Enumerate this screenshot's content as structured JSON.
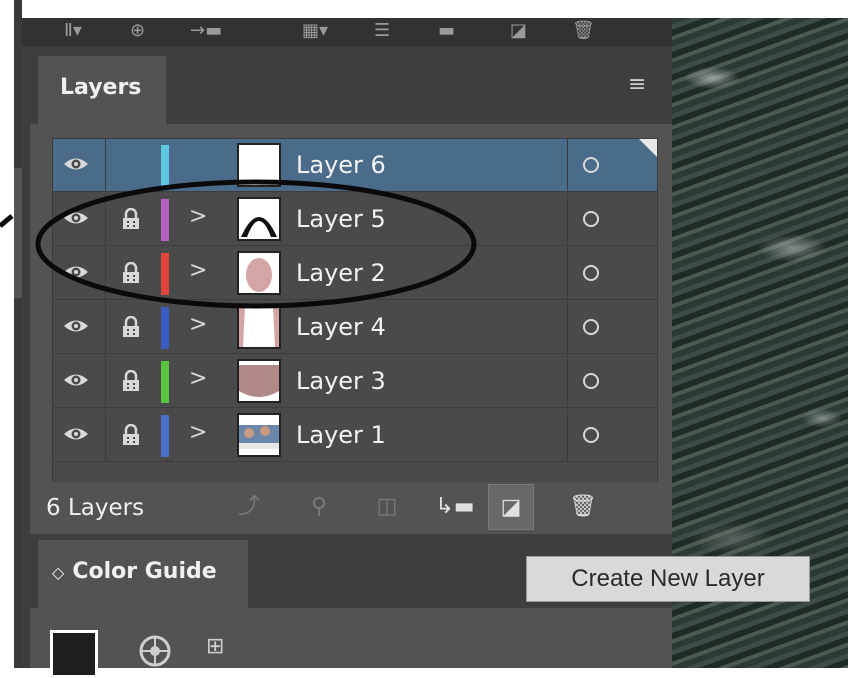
{
  "panel": {
    "tab_label": "Layers",
    "menu_icon": "hamburger-menu-icon"
  },
  "layers": [
    {
      "name": "Layer 6",
      "color": "#5ec8e0",
      "selected": true,
      "locked": false,
      "expandable": false,
      "visible": true
    },
    {
      "name": "Layer 5",
      "color": "#b660c4",
      "selected": false,
      "locked": true,
      "expandable": true,
      "visible": true
    },
    {
      "name": "Layer 2",
      "color": "#e0443c",
      "selected": false,
      "locked": true,
      "expandable": true,
      "visible": true
    },
    {
      "name": "Layer 4",
      "color": "#3a5cc2",
      "selected": false,
      "locked": true,
      "expandable": true,
      "visible": true
    },
    {
      "name": "Layer 3",
      "color": "#58c440",
      "selected": false,
      "locked": true,
      "expandable": true,
      "visible": true
    },
    {
      "name": "Layer 1",
      "color": "#4a70c8",
      "selected": false,
      "locked": true,
      "expandable": true,
      "visible": true
    }
  ],
  "footer": {
    "count_label": "6 Layers"
  },
  "color_guide": {
    "tab_label": "Color Guide",
    "tab_prefix": "◇"
  },
  "tooltip": {
    "text": "Create New Layer"
  },
  "accent": {
    "selected_row": "#4a6b8a",
    "panel_bg": "#535353"
  }
}
